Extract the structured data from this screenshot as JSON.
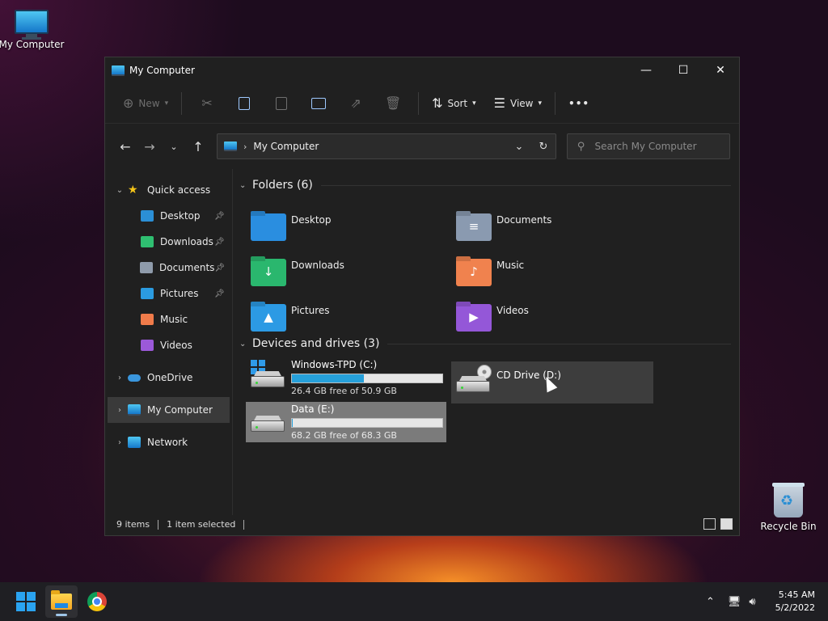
{
  "desktop": {
    "my_computer_label": "My Computer",
    "recycle_bin_label": "Recycle Bin"
  },
  "window": {
    "title": "My Computer",
    "controls": {
      "minimize": "—",
      "maximize": "☐",
      "close": "✕"
    }
  },
  "commandbar": {
    "new_label": "New",
    "sort_label": "Sort",
    "view_label": "View",
    "more_label": "•••",
    "icons": [
      "new-icon",
      "cut-icon",
      "copy-icon",
      "paste-icon",
      "rename-icon",
      "share-icon",
      "delete-icon",
      "sort-icon",
      "view-icon"
    ]
  },
  "address": {
    "location": "My Computer",
    "search_placeholder": "Search My Computer"
  },
  "nav_pane": {
    "quick_access": "Quick access",
    "items": [
      {
        "label": "Desktop",
        "color": "#2b8fd6",
        "pinned": true
      },
      {
        "label": "Downloads",
        "color": "#2fbf71",
        "pinned": true
      },
      {
        "label": "Documents",
        "color": "#8f9bab",
        "pinned": true
      },
      {
        "label": "Pictures",
        "color": "#2b9be0",
        "pinned": true
      },
      {
        "label": "Music",
        "color": "#f07b4a",
        "pinned": false
      },
      {
        "label": "Videos",
        "color": "#9b59d9",
        "pinned": false
      }
    ],
    "onedrive": "OneDrive",
    "my_computer": "My Computer",
    "network": "Network"
  },
  "folders": {
    "header": "Folders (6)",
    "items": [
      {
        "name": "Desktop",
        "color": "#2a8ee0",
        "glyph": ""
      },
      {
        "name": "Documents",
        "color": "#8a9ab0",
        "glyph": "≡"
      },
      {
        "name": "Downloads",
        "color": "#2ab76e",
        "glyph": "↓"
      },
      {
        "name": "Music",
        "color": "#f0824e",
        "glyph": "♪"
      },
      {
        "name": "Pictures",
        "color": "#2c9ae4",
        "glyph": "▲"
      },
      {
        "name": "Videos",
        "color": "#9457d8",
        "glyph": "▶"
      }
    ]
  },
  "drives": {
    "header": "Devices and drives (3)",
    "items": [
      {
        "name": "Windows-TPD (C:)",
        "free_text": "26.4 GB free of 50.9 GB",
        "used_fraction": 0.48
      },
      {
        "name": "CD Drive (D:)"
      },
      {
        "name": "Data (E:)",
        "free_text": "68.2 GB free of 68.3 GB",
        "used_fraction": 0.0015
      }
    ]
  },
  "status": {
    "items_count": "9 items",
    "selected": "1 item selected"
  },
  "taskbar": {
    "time": "5:45 AM",
    "date": "5/2/2022"
  }
}
